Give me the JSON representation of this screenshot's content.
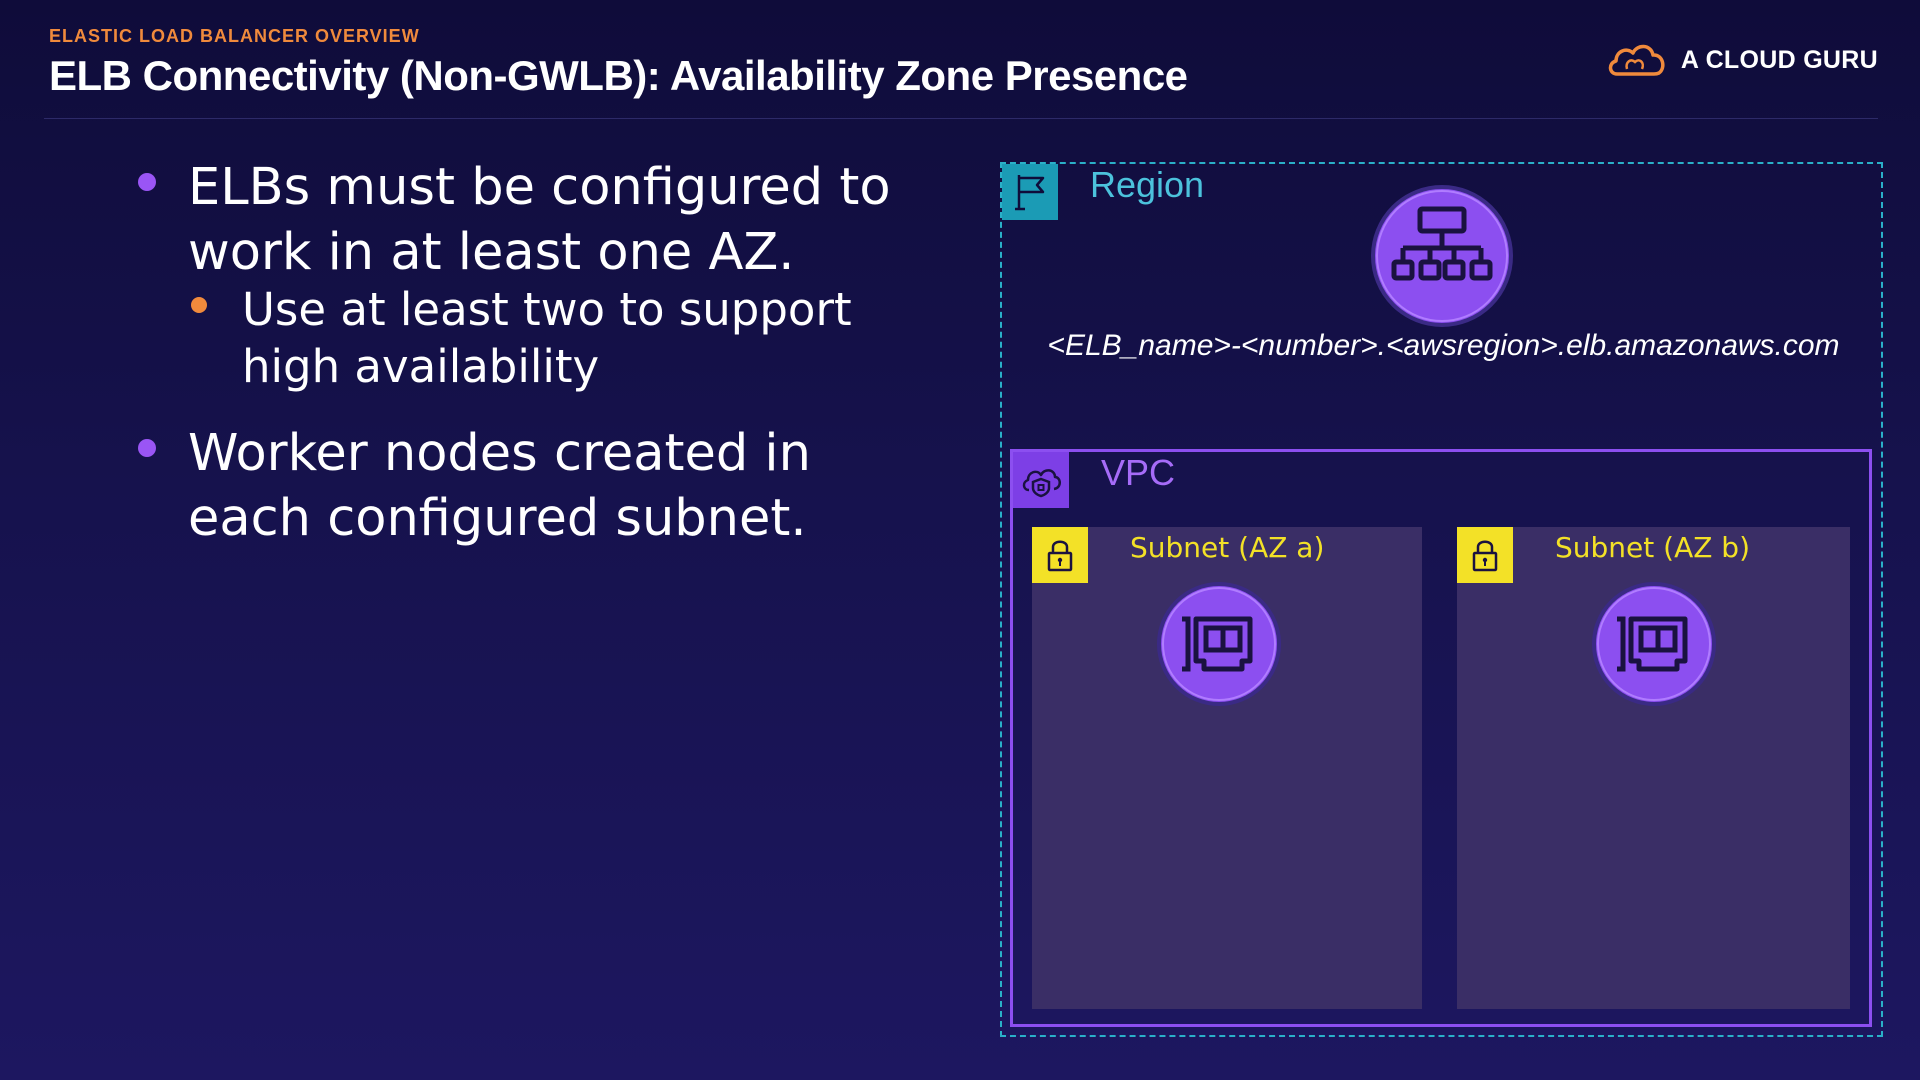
{
  "header": {
    "eyebrow": "ELASTIC LOAD BALANCER OVERVIEW",
    "title": "ELB Connectivity (Non-GWLB):  Availability Zone Presence",
    "brand": "A CLOUD GURU"
  },
  "bullets": [
    {
      "text_line1": "ELBs must be configured to",
      "text_line2": "work in at least one AZ.",
      "sub": {
        "line1": "Use at least two to support",
        "line2": "high availability"
      }
    },
    {
      "text_line1": "Worker nodes created in",
      "text_line2": "each configured subnet."
    }
  ],
  "diagram": {
    "region_label": "Region",
    "dns_name": "<ELB_name>-<number>.<awsregion>.elb.amazonaws.com",
    "vpc_label": "VPC",
    "subnets": [
      {
        "label": "Subnet (AZ a)"
      },
      {
        "label": "Subnet (AZ b)"
      }
    ],
    "icons": {
      "region": "flag-icon",
      "elb": "load-balancer-icon",
      "vpc": "vpc-cloud-icon",
      "subnet": "lock-icon",
      "node": "network-interface-icon"
    }
  },
  "colors": {
    "accent_orange": "#f08a3c",
    "purple": "#8c4ff0",
    "region_teal": "#1b9bb5",
    "subnet_yellow": "#f3e127"
  }
}
